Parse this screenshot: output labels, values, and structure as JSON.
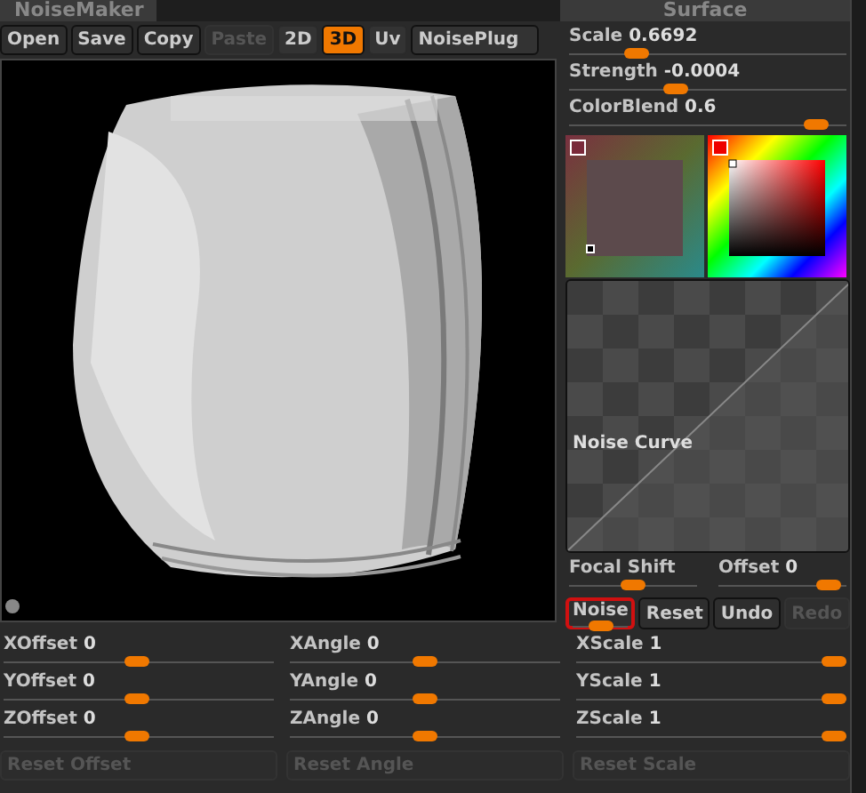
{
  "tabs": [
    {
      "label": "NoiseMaker"
    },
    {
      "label": "Surface"
    }
  ],
  "actions": [
    {
      "label": "Open",
      "disabled": false
    },
    {
      "label": "Save",
      "disabled": false
    },
    {
      "label": "Copy",
      "disabled": false
    },
    {
      "label": "Paste",
      "disabled": true
    }
  ],
  "modes": [
    {
      "label": "2D",
      "selected": false
    },
    {
      "label": "3D",
      "selected": true
    },
    {
      "label": "Uv",
      "selected": false
    }
  ],
  "plugin_button": "NoisePlug",
  "sliders": [
    {
      "label": "Scale",
      "value": "0.6692",
      "level": 0.22
    },
    {
      "label": "Strength",
      "value": "-0.0004",
      "level": 0.37
    },
    {
      "label": "ColorBlend",
      "value": "0.6",
      "level": 0.93
    }
  ],
  "noise_curve": {
    "label": "Noise Curve"
  },
  "curve_sliders": [
    {
      "label": "Focal Shift",
      "level": 0.5
    },
    {
      "label": "Offset",
      "value": "0",
      "level": 0.95
    }
  ],
  "curve_buttons": [
    {
      "label": "Noise",
      "kind": "slider",
      "highlighted": true,
      "level": 0.5,
      "disabled": false
    },
    {
      "label": "Reset",
      "kind": "button",
      "highlighted": false,
      "disabled": false
    },
    {
      "label": "Undo",
      "kind": "button",
      "highlighted": false,
      "disabled": false
    },
    {
      "label": "Redo",
      "kind": "button",
      "highlighted": false,
      "disabled": true
    }
  ],
  "transform_columns": [
    {
      "sliders": [
        {
          "label": "XOffset",
          "value": "0",
          "level": 0.49
        },
        {
          "label": "YOffset",
          "value": "0",
          "level": 0.49
        },
        {
          "label": "ZOffset",
          "value": "0",
          "level": 0.49
        }
      ],
      "reset": {
        "label": "Reset Offset",
        "disabled": true
      }
    },
    {
      "sliders": [
        {
          "label": "XAngle",
          "value": "0",
          "level": 0.5
        },
        {
          "label": "YAngle",
          "value": "0",
          "level": 0.5
        },
        {
          "label": "ZAngle",
          "value": "0",
          "level": 0.5
        }
      ],
      "reset": {
        "label": "Reset Angle",
        "disabled": true
      }
    },
    {
      "sliders": [
        {
          "label": "XScale",
          "value": "1",
          "level": 1
        },
        {
          "label": "YScale",
          "value": "1",
          "level": 1
        },
        {
          "label": "ZScale",
          "value": "1",
          "level": 1
        }
      ],
      "reset": {
        "label": "Reset Scale",
        "disabled": true
      }
    }
  ]
}
